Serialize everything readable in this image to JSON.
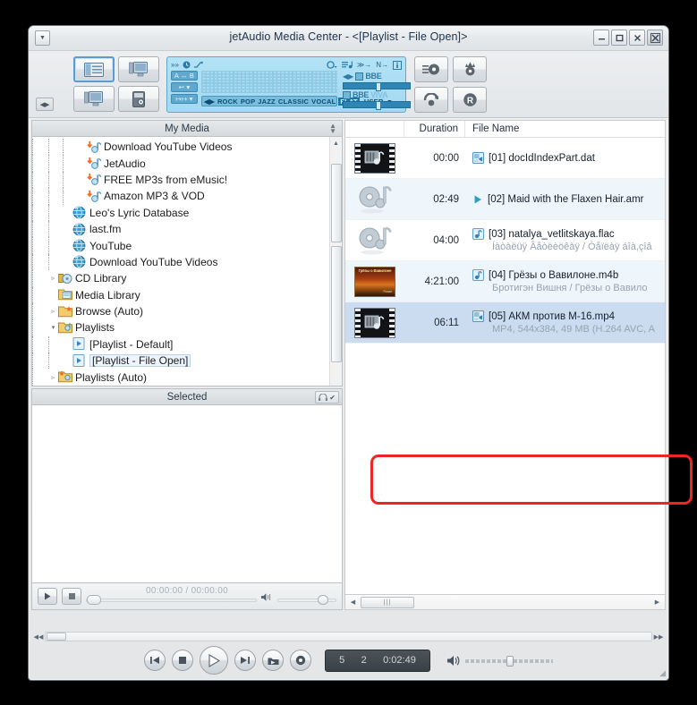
{
  "window": {
    "title": "jetAudio Media Center - <[Playlist - File Open]>",
    "sys_menu_icon": "chevron-down-icon",
    "buttons": {
      "minimize": "–",
      "maximize": "□",
      "close": "✕",
      "exit": "✕"
    }
  },
  "toolbar": {
    "mode_buttons": [
      {
        "name": "layout-playlist-button",
        "icon": "panel-layout-icon",
        "selected": true
      },
      {
        "name": "layout-screen-button",
        "icon": "monitor-icon",
        "selected": false
      },
      {
        "name": "layout-mini-button",
        "icon": "monitor-small-icon",
        "selected": false
      },
      {
        "name": "device-button",
        "icon": "device-icon",
        "selected": false
      }
    ],
    "right_buttons": [
      {
        "name": "audio-cd-button",
        "icon": "disc-record-icon",
        "label": ""
      },
      {
        "name": "burn-button",
        "icon": "flame-disc-icon",
        "label": ""
      },
      {
        "name": "convert-button",
        "icon": "convert-arrow-icon",
        "label": ""
      },
      {
        "name": "record-button",
        "icon": "record-r-icon",
        "label": "R"
      }
    ],
    "collapse_handle_icon": "collapse-handle-icon",
    "equalizer": {
      "top_icons_left": [
        "speed-icon",
        "clock-icon",
        "shuffle-icon"
      ],
      "top_icons_right": [
        "repeat-icon",
        "playlist-icon",
        "crossfade-icon",
        "normalize-icon",
        "info-icon"
      ],
      "tags": [
        "A ↔ B",
        "↩ ▾",
        "↦↦ ▾"
      ],
      "presets": [
        "ROCK",
        "POP",
        "JAZZ",
        "CLASSIC",
        "VOCAL",
        "FLAT",
        "USER"
      ],
      "active_preset": "FLAT",
      "bbe": {
        "label": "BBE",
        "enabled": true
      },
      "bbe_viva": {
        "label": "BBE",
        "label2": "VIVA",
        "enabled": true
      }
    }
  },
  "left_panel": {
    "header": "My Media",
    "tree": [
      {
        "label": "Download YouTube Videos",
        "indent": 3,
        "icon": "music-link-icon",
        "expander": "",
        "selected": false
      },
      {
        "label": "JetAudio",
        "indent": 3,
        "icon": "music-link-icon",
        "expander": "",
        "selected": false
      },
      {
        "label": "FREE MP3s from eMusic!",
        "indent": 3,
        "icon": "music-link-icon",
        "expander": "",
        "selected": false
      },
      {
        "label": "Amazon MP3 & VOD",
        "indent": 3,
        "icon": "music-link-icon",
        "expander": "",
        "selected": false
      },
      {
        "label": "Leo's Lyric Database",
        "indent": 2,
        "icon": "globe-icon",
        "expander": "",
        "selected": false
      },
      {
        "label": "last.fm",
        "indent": 2,
        "icon": "globe-icon",
        "expander": "",
        "selected": false
      },
      {
        "label": "YouTube",
        "indent": 2,
        "icon": "globe-icon",
        "expander": "",
        "selected": false
      },
      {
        "label": "Download YouTube Videos",
        "indent": 2,
        "icon": "globe-icon",
        "expander": "",
        "selected": false
      },
      {
        "label": "CD Library",
        "indent": 1,
        "icon": "cd-icon",
        "expander": "▹",
        "selected": false
      },
      {
        "label": "Media Library",
        "indent": 1,
        "icon": "library-icon",
        "expander": "",
        "selected": false
      },
      {
        "label": "Browse (Auto)",
        "indent": 1,
        "icon": "folder-star-icon",
        "expander": "▹",
        "selected": false
      },
      {
        "label": "Playlists",
        "indent": 1,
        "icon": "folder-playlist-icon",
        "expander": "▾",
        "selected": false
      },
      {
        "label": "[Playlist - Default]",
        "indent": 2,
        "icon": "playlist-file-icon",
        "expander": "",
        "selected": false
      },
      {
        "label": "[Playlist - File Open]",
        "indent": 2,
        "icon": "playlist-file-icon",
        "expander": "",
        "selected": true
      },
      {
        "label": "Playlists (Auto)",
        "indent": 1,
        "icon": "folder-playlist-auto-icon",
        "expander": "▹",
        "selected": false
      }
    ],
    "selected_panel": {
      "header": "Selected",
      "header_button_icon": "headphone-check-icon"
    },
    "mini_player": {
      "play_icon": "play-icon",
      "stop_icon": "stop-icon",
      "time": "00:00:00 / 00:00:00",
      "volume_icon": "volume-icon"
    }
  },
  "playlist": {
    "columns": {
      "thumbnail": "",
      "duration": "Duration",
      "filename": "File Name"
    },
    "rows": [
      {
        "index": "01",
        "duration": "00:00",
        "filename": "[01] docIdIndexPart.dat",
        "subtitle": "",
        "thumb": "video-filmstrip-thumb",
        "file_icon": "generic-media-icon",
        "selected": false,
        "striped": false
      },
      {
        "index": "02",
        "duration": "02:49",
        "filename": "[02] Maid with the Flaxen Hair.amr",
        "subtitle": "",
        "thumb": "audio-disc-thumb",
        "file_icon": "play-triangle-icon",
        "selected": false,
        "striped": true
      },
      {
        "index": "03",
        "duration": "04:00",
        "filename": "[03] natalya_vetlitskaya.flac",
        "subtitle": "Íàòàëüÿ Âåòëèöêàÿ / Òåïëàÿ áîà,çîâ",
        "thumb": "audio-disc-thumb",
        "file_icon": "audio-note-icon",
        "selected": false,
        "striped": false
      },
      {
        "index": "04",
        "duration": "4:21:00",
        "filename": "[04] Грёзы о Вавилоне.m4b",
        "subtitle": "Бротигэн Вишня / Грёзы о Вавило",
        "thumb": "album-art-thumb",
        "album_art_title": "Грёзы о Вавилоне",
        "album_art_sub": "Роман",
        "file_icon": "audio-note-icon",
        "selected": false,
        "striped": true
      },
      {
        "index": "05",
        "duration": "06:11",
        "filename": "[05] АКМ против М-16.mp4",
        "subtitle": "MP4, 544x384, 49 MB (H.264 AVC, A",
        "thumb": "video-filmstrip-thumb",
        "file_icon": "generic-media-icon",
        "selected": true,
        "striped": false
      }
    ],
    "hscroll": {
      "left_arrow": "◀",
      "right_arrow": "▶",
      "thumb_grip": "‖‖"
    }
  },
  "bottom_bar": {
    "hscroll": {
      "left_arrow": "◀◀",
      "right_arrow": "▶▶"
    },
    "transport": [
      {
        "name": "previous-button",
        "icon": "skip-back-icon"
      },
      {
        "name": "stop-button",
        "icon": "stop-icon"
      },
      {
        "name": "play-button",
        "icon": "play-icon"
      },
      {
        "name": "next-button",
        "icon": "skip-forward-icon"
      },
      {
        "name": "open-file-button",
        "icon": "folder-open-icon"
      },
      {
        "name": "record-button",
        "icon": "record-dot-icon"
      }
    ],
    "lcd": {
      "track_total": "5",
      "track_current": "2",
      "time": "0:02:49"
    },
    "volume_icon": "speaker-icon",
    "resize_grip_icon": "resize-grip-icon"
  },
  "annotation": {
    "color": "#ef2424",
    "target": "playlist-row-5"
  }
}
